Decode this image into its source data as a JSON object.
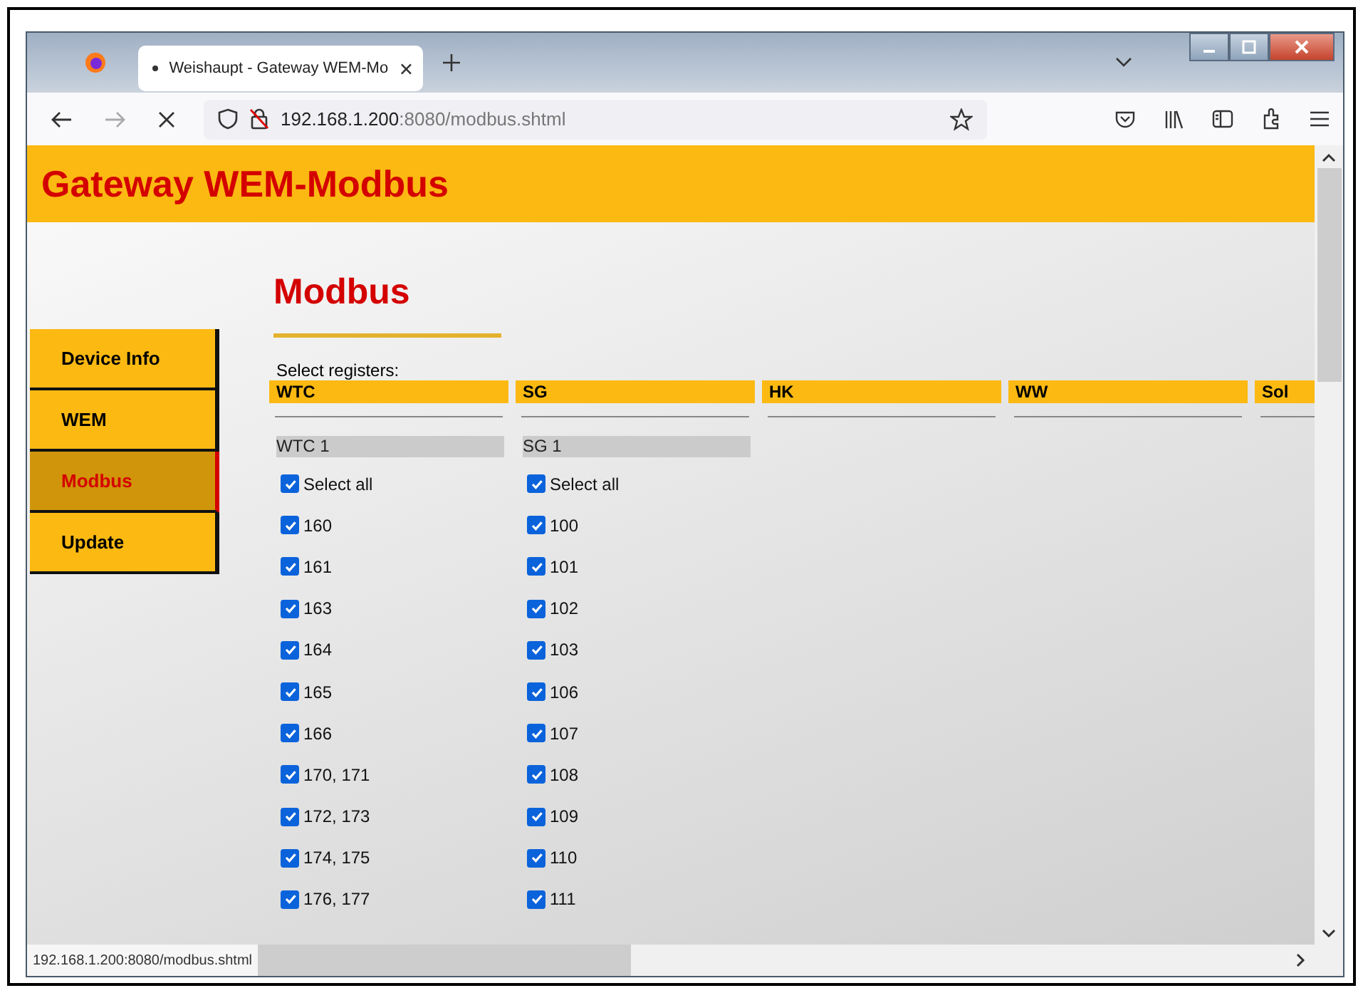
{
  "browser": {
    "tab": {
      "title": "Weishaupt - Gateway WEM-Mo",
      "selected": true
    },
    "address": {
      "host": "192.168.1.200",
      "rest": ":8080/modbus.shtml"
    },
    "status_bar": "192.168.1.200:8080/modbus.shtml"
  },
  "page": {
    "title": "Gateway WEM-Modbus",
    "sidebar": {
      "items": [
        {
          "label": "Device Info",
          "selected": false
        },
        {
          "label": "WEM",
          "selected": false
        },
        {
          "label": "Modbus",
          "selected": true
        },
        {
          "label": "Update",
          "selected": false
        }
      ]
    },
    "heading": "Modbus",
    "prompt": "Select registers:",
    "columns": [
      {
        "title": "WTC",
        "groups": [
          {
            "label": "WTC 1",
            "select_all": {
              "label": "Select all",
              "checked": true
            },
            "items": [
              {
                "label": "160",
                "checked": true
              },
              {
                "label": "161",
                "checked": true
              },
              {
                "label": "163",
                "checked": true
              },
              {
                "label": "164",
                "checked": true
              },
              {
                "label": "165",
                "checked": true
              },
              {
                "label": "166",
                "checked": true
              },
              {
                "label": "170, 171",
                "checked": true
              },
              {
                "label": "172, 173",
                "checked": true
              },
              {
                "label": "174, 175",
                "checked": true
              },
              {
                "label": "176, 177",
                "checked": true
              }
            ]
          }
        ]
      },
      {
        "title": "SG",
        "groups": [
          {
            "label": "SG 1",
            "select_all": {
              "label": "Select all",
              "checked": true
            },
            "items": [
              {
                "label": "100",
                "checked": true
              },
              {
                "label": "101",
                "checked": true
              },
              {
                "label": "102",
                "checked": true
              },
              {
                "label": "103",
                "checked": true
              },
              {
                "label": "106",
                "checked": true
              },
              {
                "label": "107",
                "checked": true
              },
              {
                "label": "108",
                "checked": true
              },
              {
                "label": "109",
                "checked": true
              },
              {
                "label": "110",
                "checked": true
              },
              {
                "label": "111",
                "checked": true
              }
            ]
          }
        ]
      },
      {
        "title": "HK"
      },
      {
        "title": "WW"
      },
      {
        "title": "Sol"
      }
    ]
  }
}
